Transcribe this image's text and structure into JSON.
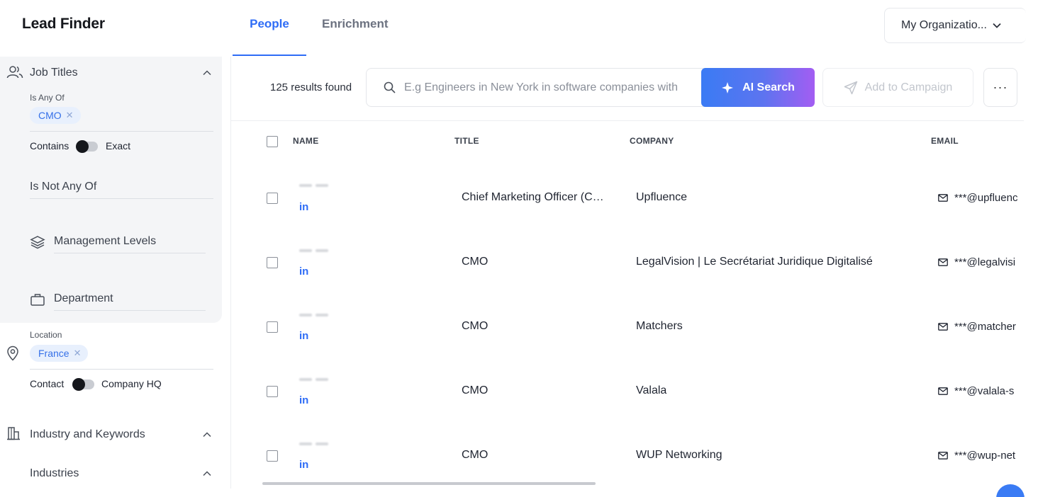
{
  "app": {
    "title": "Lead Finder"
  },
  "tabs": [
    {
      "label": "People",
      "active": true
    },
    {
      "label": "Enrichment",
      "active": false
    }
  ],
  "org_select": {
    "label": "My Organizatio..."
  },
  "sidebar": {
    "job_titles": {
      "label": "Job Titles",
      "is_any_of_label": "Is Any Of",
      "chips": [
        "CMO"
      ],
      "toggle_left": "Contains",
      "toggle_right": "Exact",
      "is_not_any_of_label": "Is Not Any Of",
      "management_levels_label": "Management Levels",
      "department_label": "Department"
    },
    "location": {
      "label": "Location",
      "chips": [
        "France"
      ],
      "toggle_left": "Contact",
      "toggle_right": "Company HQ"
    },
    "industry": {
      "label": "Industry and Keywords",
      "industries_label": "Industries"
    }
  },
  "toolbar": {
    "results_count": "125 results found",
    "search_placeholder": "E.g Engineers in New York in software companies with",
    "ai_search_label": "AI Search",
    "add_campaign_label": "Add to Campaign",
    "more_label": "···"
  },
  "table": {
    "columns": [
      "NAME",
      "TITLE",
      "COMPANY",
      "EMAIL"
    ],
    "rows": [
      {
        "linkedin": "in",
        "title": "Chief Marketing Officer (C…",
        "company": "Upfluence",
        "email": "***@upfluenc"
      },
      {
        "linkedin": "in",
        "title": "CMO",
        "company": "LegalVision | Le Secrétariat Juridique Digitalisé",
        "email": "***@legalvisi"
      },
      {
        "linkedin": "in",
        "title": "CMO",
        "company": "Matchers",
        "email": "***@matcher"
      },
      {
        "linkedin": "in",
        "title": "CMO",
        "company": "Valala",
        "email": "***@valala-s"
      },
      {
        "linkedin": "in",
        "title": "CMO",
        "company": "WUP Networking",
        "email": "***@wup-net"
      }
    ]
  },
  "colors": {
    "accent": "#2e6cf6",
    "sidebar_bg": "#f4f5f7",
    "chip_bg": "#e8f0fd"
  }
}
